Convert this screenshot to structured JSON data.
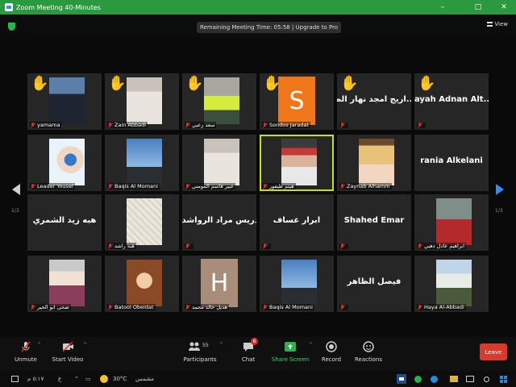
{
  "window": {
    "title": "Zoom Meeting 40-Minutes",
    "minimize": "–",
    "maximize": "□",
    "close": "✕"
  },
  "topbar": {
    "timer_text": "Remaining Meeting Time: 05:58 | Upgrade to Pro",
    "view_label": "View"
  },
  "page_indicator_left": "1/3",
  "page_indicator_right": "1/3",
  "colors": {
    "titlebar": "#2b9a3f",
    "active_speaker": "#c7e01a",
    "leave": "#d83a2e",
    "muted_mic": "#e02828",
    "raised_hand": "#f2c230",
    "accent_blue": "#2d8cff"
  },
  "participants": [
    {
      "name": "yamama",
      "hand": true,
      "muted": true,
      "kind": "photo",
      "icon": "person-dark-icon"
    },
    {
      "name": "Zain Abbadi",
      "hand": true,
      "muted": true,
      "kind": "photo",
      "icon": "person-light-icon"
    },
    {
      "name": "سعد زعبي",
      "hand": true,
      "muted": true,
      "kind": "photo",
      "icon": "person-vest-icon"
    },
    {
      "name": "Sondos Jaradat",
      "hand": true,
      "muted": true,
      "kind": "letter",
      "letter": "S"
    },
    {
      "name": "",
      "big_name": "اريج امجد نهار الط...",
      "hand": true,
      "muted": true,
      "kind": "name"
    },
    {
      "name": "",
      "big_name": "rayah Adnan Alt...",
      "hand": true,
      "muted": true,
      "kind": "name"
    },
    {
      "name": "Leader Yousef",
      "hand": false,
      "muted": true,
      "kind": "photo",
      "icon": "sticker-icon"
    },
    {
      "name": "Baqis Al Momani",
      "hand": false,
      "muted": true,
      "kind": "photo",
      "icon": "sky-photo-icon"
    },
    {
      "name": "عبير قاسم المومني",
      "hand": false,
      "muted": true,
      "kind": "photo",
      "icon": "person-light-icon"
    },
    {
      "name": "هيثم طيفور",
      "hand": false,
      "muted": true,
      "kind": "photo",
      "icon": "person-speaker-icon",
      "active": true
    },
    {
      "name": "Zaynab Alhamm",
      "hand": false,
      "muted": true,
      "kind": "photo",
      "icon": "person-blonde-icon"
    },
    {
      "name": "",
      "big_name": "rania Alkelani",
      "hand": false,
      "muted": false,
      "kind": "name"
    },
    {
      "name": "",
      "big_name": "هبه زيد الشمري",
      "hand": false,
      "muted": false,
      "kind": "name"
    },
    {
      "name": "هبه راشد",
      "hand": false,
      "muted": true,
      "kind": "photo",
      "icon": "calligraphy-icon"
    },
    {
      "name": "",
      "big_name": "إدريس مراد الرواشدة",
      "hand": false,
      "muted": true,
      "kind": "name"
    },
    {
      "name": "",
      "big_name": "ابرار عساف",
      "hand": false,
      "muted": true,
      "kind": "name"
    },
    {
      "name": "",
      "big_name": "Shahed Emar",
      "hand": false,
      "muted": true,
      "kind": "name"
    },
    {
      "name": "ابراهيم عادل ذهبي",
      "hand": false,
      "muted": true,
      "kind": "photo",
      "icon": "person-red-shirt-icon"
    },
    {
      "name": "ضحى ابو الخير",
      "hand": false,
      "muted": true,
      "kind": "photo",
      "icon": "person-hijab-icon"
    },
    {
      "name": "Batool Obeidat",
      "hand": false,
      "muted": true,
      "kind": "photo",
      "icon": "curly-hair-icon"
    },
    {
      "name": "هديل خالد محمد",
      "hand": false,
      "muted": true,
      "kind": "letter",
      "letter": "H"
    },
    {
      "name": "Baqis Al Momani",
      "hand": false,
      "muted": true,
      "kind": "photo",
      "icon": "sky-photo-icon"
    },
    {
      "name": "",
      "big_name": "فيصل الظاهر",
      "hand": false,
      "muted": true,
      "kind": "name"
    },
    {
      "name": "Haya Al-Abbadi",
      "hand": false,
      "muted": true,
      "kind": "photo",
      "icon": "person-outdoor-icon"
    }
  ],
  "toolbar": {
    "unmute": "Unmute",
    "start_video": "Start Video",
    "participants": "Participants",
    "participants_count": "55",
    "chat": "Chat",
    "chat_badge": "6",
    "share_screen": "Share Screen",
    "record": "Record",
    "reactions": "Reactions",
    "leave": "Leave"
  },
  "taskbar": {
    "language": "ع",
    "time": "٥:١٧ م",
    "weather_temp": "30°C",
    "weather_label": "مشمس"
  }
}
